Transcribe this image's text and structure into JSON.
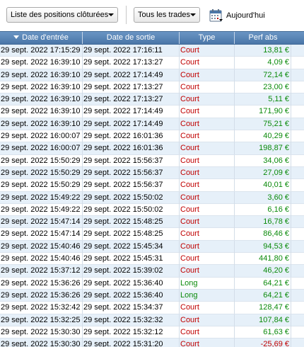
{
  "toolbar": {
    "positions_filter": "Liste des positions clôturées",
    "trades_filter": "Tous les trades",
    "today_label": "Aujourd'hui"
  },
  "table": {
    "headers": [
      "Date d'entrée",
      "Date de sortie",
      "Type",
      "Perf abs"
    ],
    "rows": [
      {
        "entry": "29 sept. 2022 17:15:29",
        "exit": "29 sept. 2022 17:16:11",
        "type": "Court",
        "perf": "13,81 €"
      },
      {
        "entry": "29 sept. 2022 16:39:10",
        "exit": "29 sept. 2022 17:13:27",
        "type": "Court",
        "perf": "4,09 €"
      },
      {
        "entry": "29 sept. 2022 16:39:10",
        "exit": "29 sept. 2022 17:14:49",
        "type": "Court",
        "perf": "72,14 €"
      },
      {
        "entry": "29 sept. 2022 16:39:10",
        "exit": "29 sept. 2022 17:13:27",
        "type": "Court",
        "perf": "23,00 €"
      },
      {
        "entry": "29 sept. 2022 16:39:10",
        "exit": "29 sept. 2022 17:13:27",
        "type": "Court",
        "perf": "5,11 €"
      },
      {
        "entry": "29 sept. 2022 16:39:10",
        "exit": "29 sept. 2022 17:14:49",
        "type": "Court",
        "perf": "171,90 €"
      },
      {
        "entry": "29 sept. 2022 16:39:10",
        "exit": "29 sept. 2022 17:14:49",
        "type": "Court",
        "perf": "75,21 €"
      },
      {
        "entry": "29 sept. 2022 16:00:07",
        "exit": "29 sept. 2022 16:01:36",
        "type": "Court",
        "perf": "40,29 €"
      },
      {
        "entry": "29 sept. 2022 16:00:07",
        "exit": "29 sept. 2022 16:01:36",
        "type": "Court",
        "perf": "198,87 €"
      },
      {
        "entry": "29 sept. 2022 15:50:29",
        "exit": "29 sept. 2022 15:56:37",
        "type": "Court",
        "perf": "34,06 €"
      },
      {
        "entry": "29 sept. 2022 15:50:29",
        "exit": "29 sept. 2022 15:56:37",
        "type": "Court",
        "perf": "27,09 €"
      },
      {
        "entry": "29 sept. 2022 15:50:29",
        "exit": "29 sept. 2022 15:56:37",
        "type": "Court",
        "perf": "40,01 €"
      },
      {
        "entry": "29 sept. 2022 15:49:22",
        "exit": "29 sept. 2022 15:50:02",
        "type": "Court",
        "perf": "3,60 €"
      },
      {
        "entry": "29 sept. 2022 15:49:22",
        "exit": "29 sept. 2022 15:50:02",
        "type": "Court",
        "perf": "6,16 €"
      },
      {
        "entry": "29 sept. 2022 15:47:14",
        "exit": "29 sept. 2022 15:48:25",
        "type": "Court",
        "perf": "16,78 €"
      },
      {
        "entry": "29 sept. 2022 15:47:14",
        "exit": "29 sept. 2022 15:48:25",
        "type": "Court",
        "perf": "86,46 €"
      },
      {
        "entry": "29 sept. 2022 15:40:46",
        "exit": "29 sept. 2022 15:45:34",
        "type": "Court",
        "perf": "94,53 €"
      },
      {
        "entry": "29 sept. 2022 15:40:46",
        "exit": "29 sept. 2022 15:45:31",
        "type": "Court",
        "perf": "441,80 €"
      },
      {
        "entry": "29 sept. 2022 15:37:12",
        "exit": "29 sept. 2022 15:39:02",
        "type": "Court",
        "perf": "46,20 €"
      },
      {
        "entry": "29 sept. 2022 15:36:26",
        "exit": "29 sept. 2022 15:36:40",
        "type": "Long",
        "perf": "64,21 €"
      },
      {
        "entry": "29 sept. 2022 15:36:26",
        "exit": "29 sept. 2022 15:36:40",
        "type": "Long",
        "perf": "64,21 €"
      },
      {
        "entry": "29 sept. 2022 15:32:42",
        "exit": "29 sept. 2022 15:34:37",
        "type": "Court",
        "perf": "128,47 €"
      },
      {
        "entry": "29 sept. 2022 15:32:25",
        "exit": "29 sept. 2022 15:32:32",
        "type": "Court",
        "perf": "107,84 €"
      },
      {
        "entry": "29 sept. 2022 15:30:30",
        "exit": "29 sept. 2022 15:32:12",
        "type": "Court",
        "perf": "61,63 €"
      },
      {
        "entry": "29 sept. 2022 15:30:30",
        "exit": "29 sept. 2022 15:31:20",
        "type": "Court",
        "perf": "-25,69 €"
      }
    ]
  },
  "colors": {
    "header_bg": "#4a76a8",
    "row_alt": "#e6f0f9",
    "court": "#c00000",
    "long": "#0a8a0a",
    "positive": "#0a8a0a",
    "negative": "#c00000"
  },
  "icons": {
    "dropdown": "chevron-down-icon",
    "today": "calendar-icon",
    "sort": "sort-desc-icon"
  }
}
